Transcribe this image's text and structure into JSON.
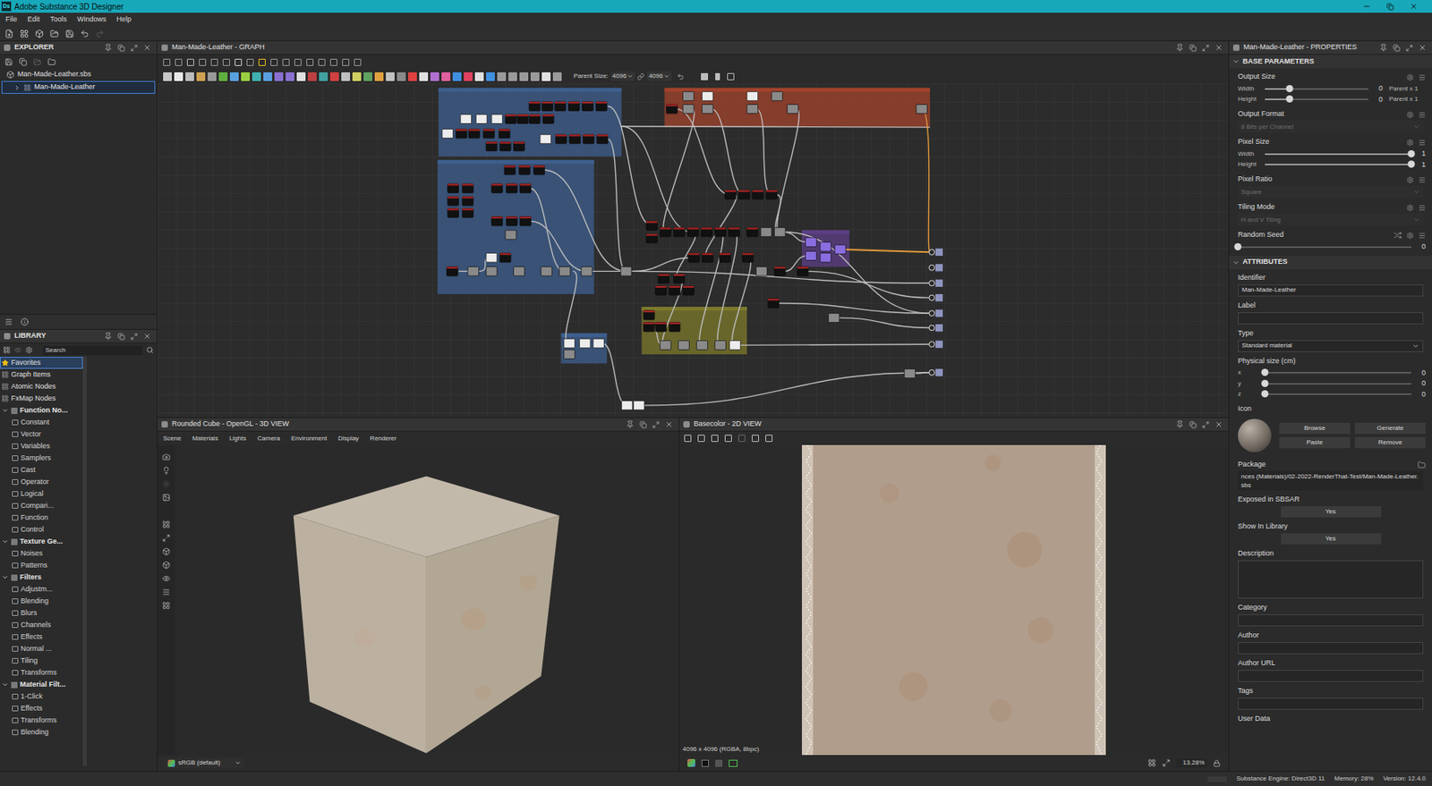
{
  "window": {
    "title": "Adobe Substance 3D Designer",
    "icon": "Ds"
  },
  "menu": [
    "File",
    "Edit",
    "Tools",
    "Windows",
    "Help"
  ],
  "explorer": {
    "title": "EXPLORER",
    "package": {
      "label": "Man-Made-Leather.sbs",
      "expanded": true,
      "graphs": [
        {
          "label": "Man-Made-Leather",
          "selected": true,
          "expanded": false
        }
      ]
    }
  },
  "library": {
    "title": "LIBRARY",
    "search": {
      "placeholder": "Search"
    },
    "items": [
      {
        "label": "Favorites",
        "kind": "root",
        "selected": true
      },
      {
        "label": "Graph Items",
        "kind": "root",
        "selected": false
      },
      {
        "label": "Atomic Nodes",
        "kind": "root",
        "selected": false
      },
      {
        "label": "FxMap Nodes",
        "kind": "root",
        "selected": false
      },
      {
        "label": "Function No...",
        "kind": "section",
        "expanded": true,
        "selected": false
      },
      {
        "label": "Constant",
        "kind": "child",
        "selected": false
      },
      {
        "label": "Vector",
        "kind": "child",
        "selected": false
      },
      {
        "label": "Variables",
        "kind": "child",
        "selected": false
      },
      {
        "label": "Samplers",
        "kind": "child",
        "selected": false
      },
      {
        "label": "Cast",
        "kind": "child",
        "selected": false
      },
      {
        "label": "Operator",
        "kind": "child",
        "selected": false
      },
      {
        "label": "Logical",
        "kind": "child",
        "selected": false
      },
      {
        "label": "Compari...",
        "kind": "child",
        "selected": false
      },
      {
        "label": "Function",
        "kind": "child",
        "selected": false
      },
      {
        "label": "Control",
        "kind": "child",
        "selected": false
      },
      {
        "label": "Texture Ge...",
        "kind": "section",
        "expanded": true,
        "selected": false
      },
      {
        "label": "Noises",
        "kind": "child",
        "selected": false
      },
      {
        "label": "Patterns",
        "kind": "child",
        "selected": false
      },
      {
        "label": "Filters",
        "kind": "section",
        "expanded": true,
        "selected": false
      },
      {
        "label": "Adjustm...",
        "kind": "child",
        "selected": false
      },
      {
        "label": "Blending",
        "kind": "child",
        "selected": false
      },
      {
        "label": "Blurs",
        "kind": "child",
        "selected": false
      },
      {
        "label": "Channels",
        "kind": "child",
        "selected": false
      },
      {
        "label": "Effects",
        "kind": "child",
        "selected": false
      },
      {
        "label": "Normal ...",
        "kind": "child",
        "selected": false
      },
      {
        "label": "Tiling",
        "kind": "child",
        "selected": false
      },
      {
        "label": "Transforms",
        "kind": "child",
        "selected": false
      },
      {
        "label": "Material Filt...",
        "kind": "section",
        "expanded": true,
        "selected": false
      },
      {
        "label": "1-Click",
        "kind": "child",
        "selected": false
      },
      {
        "label": "Effects",
        "kind": "child",
        "selected": false
      },
      {
        "label": "Transforms",
        "kind": "child",
        "selected": false
      },
      {
        "label": "Blending",
        "kind": "child",
        "selected": false
      }
    ]
  },
  "graph": {
    "title": "Man-Made-Leather - GRAPH",
    "parent_size_label": "Parent Size:",
    "width": "4096",
    "height": "4096",
    "frames": [
      {
        "color": "#3d5f8f"
      },
      {
        "color": "#a3432c"
      },
      {
        "color": "#3d5f8f"
      },
      {
        "color": "#5c3f85"
      },
      {
        "color": "#7d7a2c"
      },
      {
        "color": "#3d5f8f"
      }
    ]
  },
  "view3d": {
    "title": "Rounded Cube - OpenGL - 3D VIEW",
    "menu": [
      "Scene",
      "Materials",
      "Lights",
      "Camera",
      "Environment",
      "Display",
      "Renderer"
    ],
    "colorspace": "sRGB (default)"
  },
  "view2d": {
    "title": "Basecolor - 2D VIEW",
    "resolution": "4096 x 4096 (RGBA, 8bpc)",
    "zoom": "13.28%"
  },
  "properties": {
    "title": "Man-Made-Leather - PROPERTIES",
    "sections": [
      {
        "title": "BASE PARAMETERS",
        "expanded": true,
        "rows": [
          {
            "kind": "sliders",
            "label": "Output Size",
            "sliders": [
              {
                "name": "Width",
                "value": "0",
                "level": 0.24,
                "suffix": "Parent x 1"
              },
              {
                "name": "Height",
                "value": "0",
                "level": 0.24,
                "suffix": "Parent x 1"
              }
            ]
          },
          {
            "kind": "dropdown",
            "label": "Output Format",
            "value": "8 Bits per Channel",
            "disabled": true
          },
          {
            "kind": "sliders",
            "label": "Pixel Size",
            "sliders": [
              {
                "name": "Width",
                "value": "1",
                "level": 1
              },
              {
                "name": "Height",
                "value": "1",
                "level": 1
              }
            ]
          },
          {
            "kind": "dropdown",
            "label": "Pixel Ratio",
            "value": "Square",
            "disabled": true
          },
          {
            "kind": "dropdown",
            "label": "Tiling Mode",
            "value": "H and V Tiling",
            "disabled": true
          },
          {
            "kind": "sliders",
            "label": "Random Seed",
            "shuffle": true,
            "sliders": [
              {
                "value": "0",
                "level": 0
              }
            ]
          }
        ]
      },
      {
        "title": "ATTRIBUTES",
        "expanded": true,
        "rows": [
          {
            "kind": "text",
            "label": "Identifier",
            "value": "Man-Made-Leather"
          },
          {
            "kind": "text",
            "label": "Label",
            "value": ""
          },
          {
            "kind": "dropdown",
            "label": "Type",
            "value": "Standard material",
            "disabled": false
          },
          {
            "kind": "sliders",
            "label": "Physical size (cm)",
            "sliders": [
              {
                "name": "x",
                "value": "0",
                "level": 0
              },
              {
                "name": "y",
                "value": "0",
                "level": 0
              },
              {
                "name": "z",
                "value": "0",
                "level": 0
              }
            ]
          },
          {
            "kind": "icon",
            "label": "Icon",
            "buttons": [
              "Browse",
              "Generate",
              "Paste",
              "Remove"
            ]
          },
          {
            "kind": "path",
            "label": "Package",
            "value": "nces (Materials)/02-2022-RenderThat-Test/Man-Made-Leather.sbs"
          },
          {
            "kind": "button",
            "label": "Exposed in SBSAR",
            "value": "Yes"
          },
          {
            "kind": "button",
            "label": "Show In Library",
            "value": "Yes"
          },
          {
            "kind": "textarea",
            "label": "Description",
            "value": ""
          },
          {
            "kind": "text",
            "label": "Category",
            "value": ""
          },
          {
            "kind": "text",
            "label": "Author",
            "value": ""
          },
          {
            "kind": "text",
            "label": "Author URL",
            "value": ""
          },
          {
            "kind": "text",
            "label": "Tags",
            "value": ""
          },
          {
            "kind": "label",
            "label": "User Data"
          }
        ]
      }
    ]
  },
  "status_bar": {
    "engine": "Substance Engine: Direct3D 11",
    "memory": "Memory: 28%",
    "version": "Version: 12.4.0"
  }
}
